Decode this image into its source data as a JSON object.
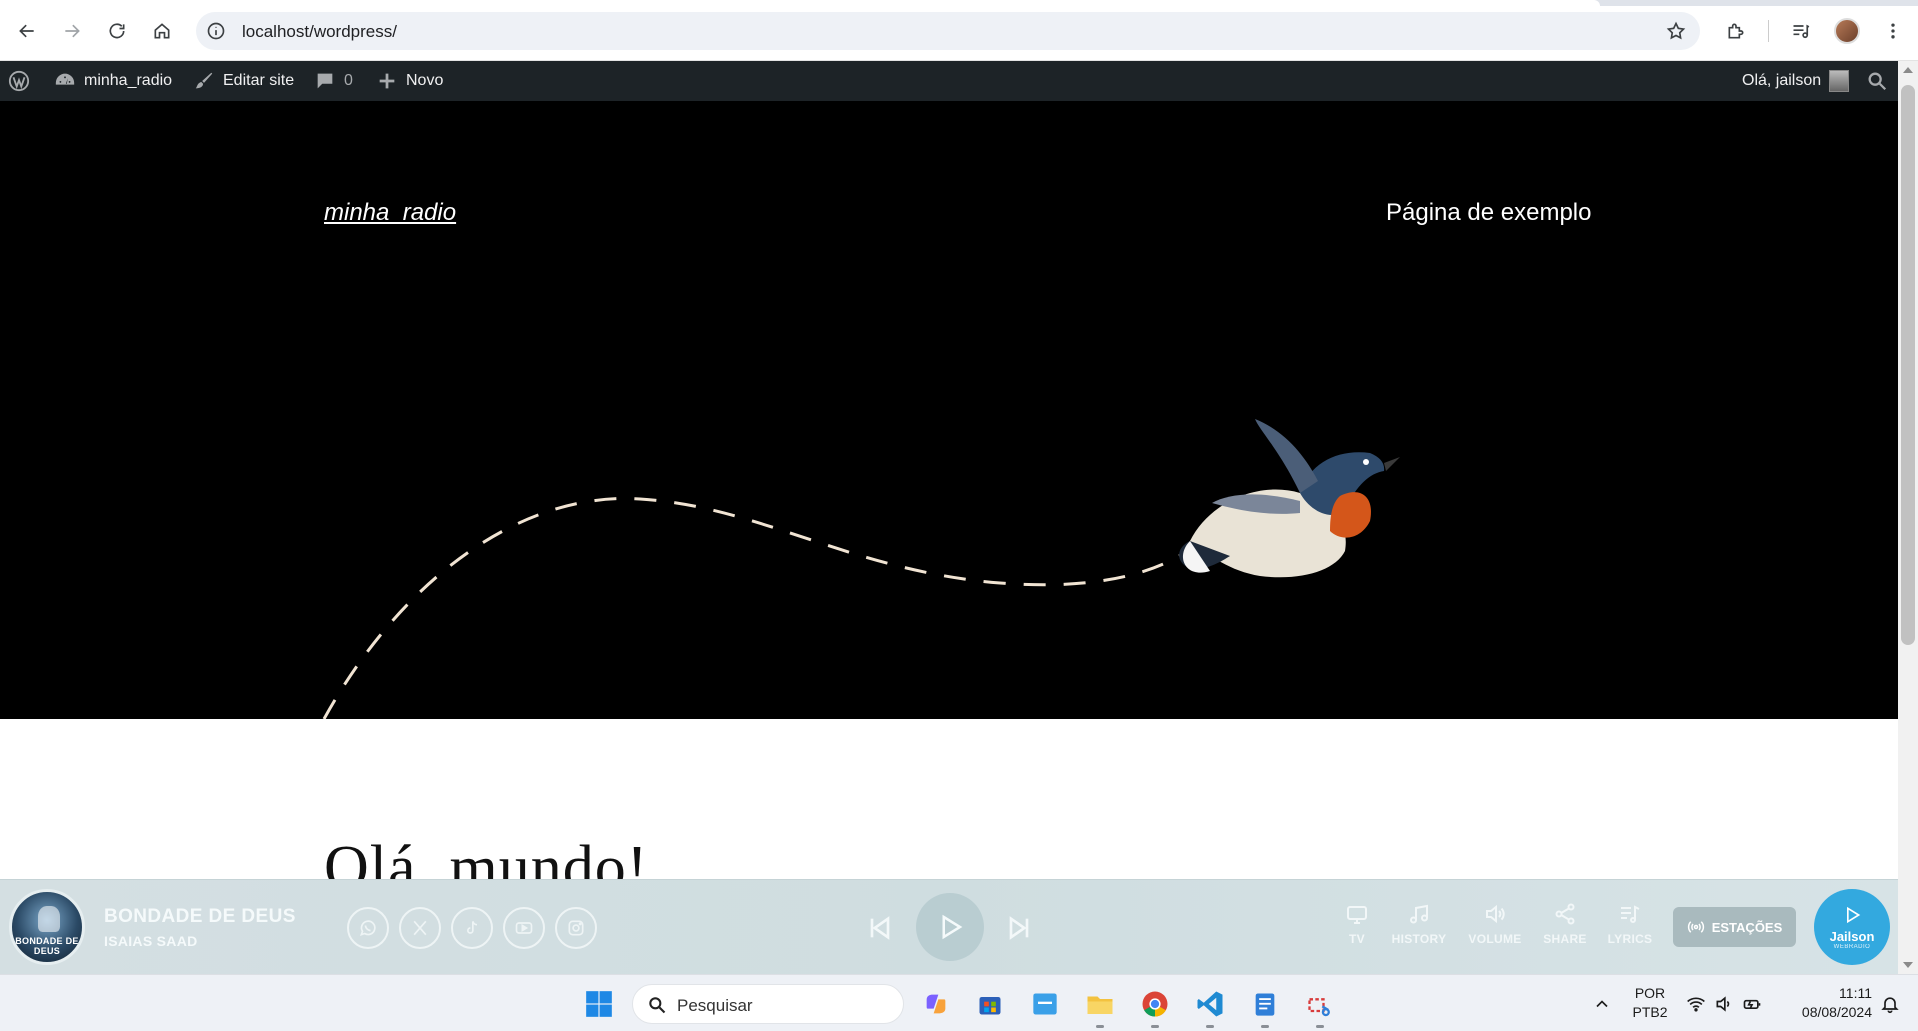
{
  "browser": {
    "url": "localhost/wordpress/"
  },
  "adminbar": {
    "site_name": "minha_radio",
    "edit_site": "Editar site",
    "comments_count": "0",
    "new_label": "Novo",
    "greeting": "Olá, jailson"
  },
  "site": {
    "title": "minha_radio",
    "nav_item": "Página de exemplo",
    "post_title": "Olá, mundo!"
  },
  "player": {
    "cover_text": "BONDADE DE DEUS",
    "song_title": "BONDADE DE DEUS",
    "artist": "ISAIAS SAAD",
    "tools": [
      "TV",
      "HISTORY",
      "VOLUME",
      "SHARE",
      "LYRICS"
    ],
    "stations_label": "ESTAÇÕES",
    "live_name": "Jailson",
    "live_sub": "WEBRADIO",
    "accent_color": "#33a9df"
  },
  "taskbar": {
    "search_placeholder": "Pesquisar",
    "lang_line1": "POR",
    "lang_line2": "PTB2",
    "time": "11:11",
    "date": "08/08/2024"
  }
}
